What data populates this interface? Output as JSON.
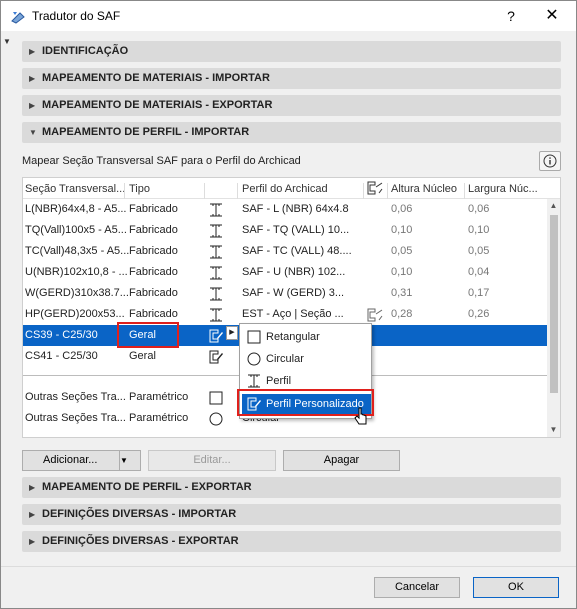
{
  "window": {
    "title": "Tradutor do SAF",
    "help": "?",
    "close": "✕"
  },
  "sections_top": [
    {
      "label": "IDENTIFICAÇÃO",
      "expanded": false
    },
    {
      "label": "MAPEAMENTO DE MATERIAIS - IMPORTAR",
      "expanded": false
    },
    {
      "label": "MAPEAMENTO DE MATERIAIS - EXPORTAR",
      "expanded": false
    },
    {
      "label": "MAPEAMENTO DE PERFIL - IMPORTAR",
      "expanded": true
    }
  ],
  "profile_import": {
    "description": "Mapear Seção Transversal SAF para o Perfil do Archicad",
    "info_icon": "info-icon",
    "columns": {
      "section": "Seção Transversal...",
      "type": "Tipo",
      "profile": "Perfil do Archicad",
      "core_height": "Altura Núcleo",
      "core_width": "Largura Núc..."
    },
    "rows": [
      {
        "section": "L(NBR)64x4,8 - A5...",
        "type": "Fabricado",
        "icon": "profile-icon",
        "profile": "SAF - L (NBR) 64x4.8",
        "height": "0,06",
        "width": "0,06"
      },
      {
        "section": "TQ(Vall)100x5 - A5...",
        "type": "Fabricado",
        "icon": "profile-icon",
        "profile": "SAF - TQ (VALL) 10...",
        "height": "0,10",
        "width": "0,10"
      },
      {
        "section": "TC(Vall)48,3x5 - A5...",
        "type": "Fabricado",
        "icon": "profile-icon",
        "profile": "SAF - TC (VALL) 48....",
        "height": "0,05",
        "width": "0,05"
      },
      {
        "section": "U(NBR)102x10,8 - ...",
        "type": "Fabricado",
        "icon": "profile-icon",
        "profile": "SAF - U (NBR) 102...",
        "height": "0,10",
        "width": "0,04"
      },
      {
        "section": "W(GERD)310x38.7...",
        "type": "Fabricado",
        "icon": "profile-icon",
        "profile": "SAF - W (GERD) 3...",
        "height": "0,31",
        "width": "0,17"
      },
      {
        "section": "HP(GERD)200x53...",
        "type": "Fabricado",
        "icon": "profile-icon",
        "profile": "EST - Aço | Seção ...",
        "height": "0,28",
        "width": "0,26"
      },
      {
        "section": "CS39 - C25/30",
        "type": "Geral",
        "icon": "custom-profile-icon",
        "profile": "",
        "height": "",
        "width": ""
      },
      {
        "section": "CS41 - C25/30",
        "type": "Geral",
        "icon": "custom-profile-icon",
        "profile": "",
        "height": "",
        "width": ""
      }
    ],
    "other_rows": [
      {
        "section": "Outras Seções Tra...",
        "type": "Paramétrico",
        "icon": "rectangle-icon",
        "profile": ""
      },
      {
        "section": "Outras Seções Tra...",
        "type": "Paramétrico",
        "icon": "circle-icon",
        "profile": "Circular"
      }
    ],
    "shape_menu": [
      {
        "label": "Retangular",
        "icon": "rectangle-icon"
      },
      {
        "label": "Circular",
        "icon": "circle-icon"
      },
      {
        "label": "Perfil",
        "icon": "profile-icon"
      },
      {
        "label": "Perfil Personalizado",
        "icon": "custom-profile-icon",
        "highlighted": true
      }
    ],
    "buttons": {
      "add": "Adicionar...",
      "edit": "Editar...",
      "delete": "Apagar"
    }
  },
  "sections_bottom": [
    {
      "label": "MAPEAMENTO DE PERFIL - EXPORTAR",
      "expanded": false
    },
    {
      "label": "DEFINIÇÕES DIVERSAS - IMPORTAR",
      "expanded": false
    },
    {
      "label": "DEFINIÇÕES DIVERSAS - EXPORTAR",
      "expanded": false
    }
  ],
  "footer": {
    "cancel": "Cancelar",
    "ok": "OK"
  },
  "colors": {
    "selection": "#0a64c6",
    "annotation": "#e0201c"
  }
}
